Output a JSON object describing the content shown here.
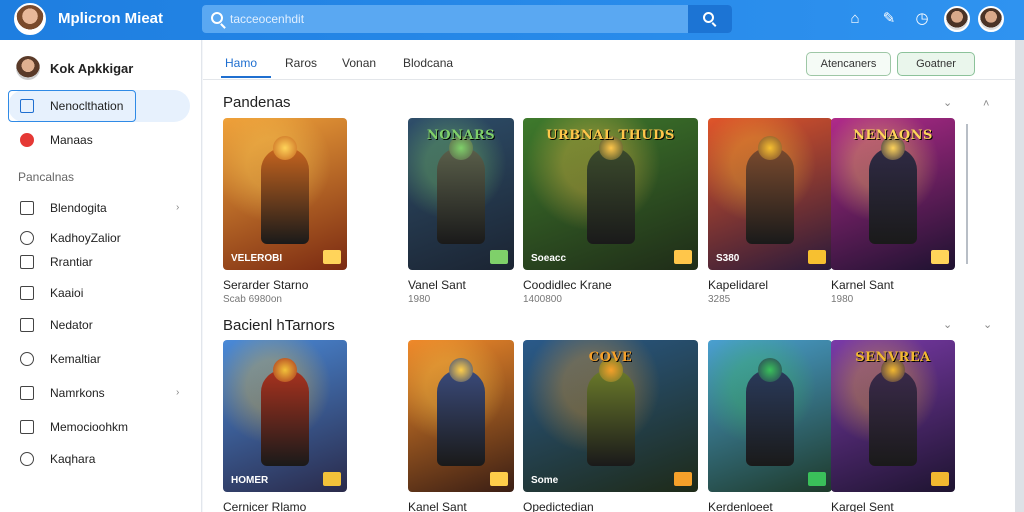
{
  "app": {
    "title": "Mplicron Mieat"
  },
  "search": {
    "placeholder": "tacceocenhdit"
  },
  "sidebar": {
    "user_name": "Kok Apkkigar",
    "active_item": "Nenoclthation",
    "item_2": "Manaas",
    "section_label": "Pancalnas",
    "items": [
      {
        "label": "Blendogita",
        "icon": "book-icon",
        "chevron": true
      },
      {
        "label": "KadhoyZalior",
        "icon": "gamepad-icon",
        "chevron": false
      },
      {
        "label": "Rrantiar",
        "icon": "image-icon",
        "chevron": false
      },
      {
        "label": "Kaaioi",
        "icon": "calendar-icon",
        "chevron": false
      },
      {
        "label": "Nedator",
        "icon": "monitor-icon",
        "chevron": false
      },
      {
        "label": "Kemaltiar",
        "icon": "person-icon",
        "chevron": false
      },
      {
        "label": "Namrkons",
        "icon": "list-icon",
        "chevron": true
      },
      {
        "label": "Memocioohkm",
        "icon": "phone-icon",
        "chevron": false
      },
      {
        "label": "Kaqhara",
        "icon": "pin-icon",
        "chevron": false
      }
    ]
  },
  "tabs": [
    "Hamo",
    "Raros",
    "Vonan",
    "Blodcana"
  ],
  "actions": {
    "primary": "Atencaners",
    "secondary": "Goatner"
  },
  "sections": [
    {
      "title": "Pandenas",
      "cards": [
        {
          "banner": "",
          "tag": "VELEROBI",
          "title": "Serarder Starno",
          "meta": "Scab 6980on",
          "bg1": "#f0a23a",
          "bg2": "#7a2a12",
          "hero": "#c6641e",
          "accent": "#ffd45a"
        },
        {
          "banner": "NONARS",
          "tag": "",
          "title": "Vanel Sant",
          "meta": "1980",
          "bg1": "#2e4e6a",
          "bg2": "#1b2432",
          "hero": "#5a5f4a",
          "accent": "#7fd06a"
        },
        {
          "banner": "URBNAL THUDS",
          "tag": "Soeacc",
          "title": "Coodidlec Krane",
          "meta": "1400800",
          "bg1": "#3e7a2c",
          "bg2": "#1f2c18",
          "hero": "#3b4a2c",
          "accent": "#ffc64a"
        },
        {
          "banner": "",
          "tag": "S380",
          "title": "Kapelidarel",
          "meta": "3285",
          "bg1": "#e0552a",
          "bg2": "#2a1a3a",
          "hero": "#7a4a2e",
          "accent": "#f7c030"
        },
        {
          "banner": "NENAQNS",
          "tag": "",
          "title": "Karnel Sant",
          "meta": "1980",
          "bg1": "#b02a8a",
          "bg2": "#1e1230",
          "hero": "#2f2a44",
          "accent": "#ffd45a"
        }
      ]
    },
    {
      "title": "Bacienl hTarnors",
      "cards": [
        {
          "banner": "",
          "tag": "HOMER",
          "title": "Cernicer Rlamo",
          "meta": "",
          "bg1": "#4a8ad8",
          "bg2": "#2a2a4a",
          "hero": "#a8321e",
          "accent": "#f2c23a"
        },
        {
          "banner": "",
          "tag": "",
          "title": "Kanel Sant",
          "meta": "",
          "bg1": "#f08a2a",
          "bg2": "#3a1e14",
          "hero": "#3a4a7a",
          "accent": "#ffce4a"
        },
        {
          "banner": "COVE",
          "tag": "Some",
          "title": "Opedictedian",
          "meta": "",
          "bg1": "#2a5a8a",
          "bg2": "#1e2a18",
          "hero": "#6a7a2a",
          "accent": "#f5a02a"
        },
        {
          "banner": "",
          "tag": "",
          "title": "Kerdenloeet",
          "meta": "",
          "bg1": "#4aa0d0",
          "bg2": "#1e3a2a",
          "hero": "#2a3a5a",
          "accent": "#3ac05a"
        },
        {
          "banner": "SENVREA",
          "tag": "",
          "title": "Kargel Sent",
          "meta": "",
          "bg1": "#7a3aa8",
          "bg2": "#1e1430",
          "hero": "#3a2a4a",
          "accent": "#f2b830"
        }
      ]
    }
  ]
}
